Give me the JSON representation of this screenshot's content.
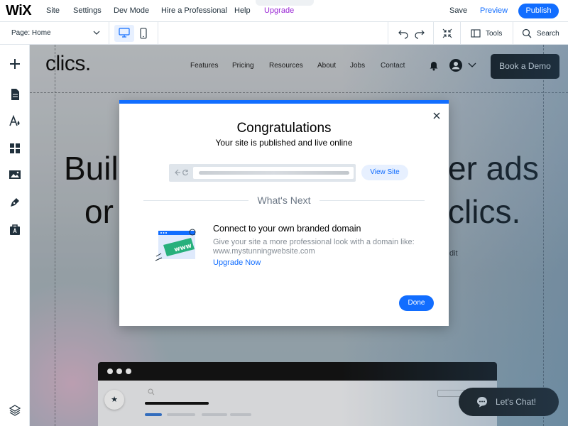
{
  "topbar": {
    "logo": "WiX",
    "menu": [
      "Site",
      "Settings",
      "Dev Mode",
      "Hire a Professional",
      "Help",
      "Upgrade"
    ],
    "save": "Save",
    "preview": "Preview",
    "publish": "Publish"
  },
  "toolbar": {
    "page_prefix": "Page:",
    "page_name": "Home",
    "tools": "Tools",
    "search": "Search"
  },
  "leftrail": {
    "icons": [
      "add-icon",
      "pages-icon",
      "theme-icon",
      "apps-icon",
      "media-icon",
      "pen-icon",
      "business-icon",
      "layers-icon"
    ]
  },
  "site": {
    "logo": "clics.",
    "nav": [
      "Features",
      "Pricing",
      "Resources",
      "About",
      "Jobs",
      "Contact"
    ],
    "book_demo": "Book a Demo",
    "hero_fragments": [
      "Buil",
      "er ads",
      "or",
      "clics."
    ],
    "dit": "dit",
    "chat": "Let's Chat!"
  },
  "modal": {
    "title": "Congratulations",
    "subtitle": "Your site is published and live online",
    "view_site": "View Site",
    "whats_next": "What's Next",
    "www_badge": "www",
    "domain_title": "Connect to your own branded domain",
    "domain_desc_1": "Give your site a more professional look with a domain like:",
    "domain_desc_2": "www.mystunningwebsite.com",
    "upgrade_link": "Upgrade Now",
    "done": "Done"
  },
  "colors": {
    "accent": "#116dff",
    "upgrade": "#9a27d5"
  }
}
